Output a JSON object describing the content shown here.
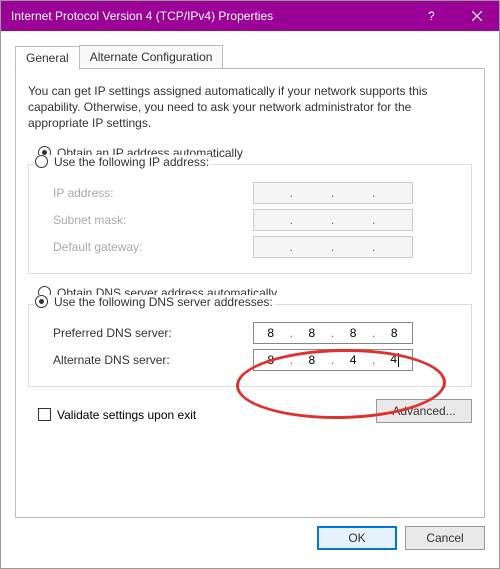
{
  "window": {
    "title": "Internet Protocol Version 4 (TCP/IPv4) Properties"
  },
  "tabs": {
    "general": "General",
    "alternate": "Alternate Configuration"
  },
  "intro": "You can get IP settings assigned automatically if your network supports this capability. Otherwise, you need to ask your network administrator for the appropriate IP settings.",
  "ip": {
    "auto_label": "Obtain an IP address automatically",
    "manual_label": "Use the following IP address:",
    "ip_label": "IP address:",
    "subnet_label": "Subnet mask:",
    "gateway_label": "Default gateway:"
  },
  "dns": {
    "auto_label": "Obtain DNS server address automatically",
    "manual_label": "Use the following DNS server addresses:",
    "preferred_label": "Preferred DNS server:",
    "alternate_label": "Alternate DNS server:",
    "preferred": {
      "a": "8",
      "b": "8",
      "c": "8",
      "d": "8"
    },
    "alternate": {
      "a": "8",
      "b": "8",
      "c": "4",
      "d": "4"
    }
  },
  "validate_label": "Validate settings upon exit",
  "advanced_label": "Advanced...",
  "ok_label": "OK",
  "cancel_label": "Cancel",
  "dot": "."
}
